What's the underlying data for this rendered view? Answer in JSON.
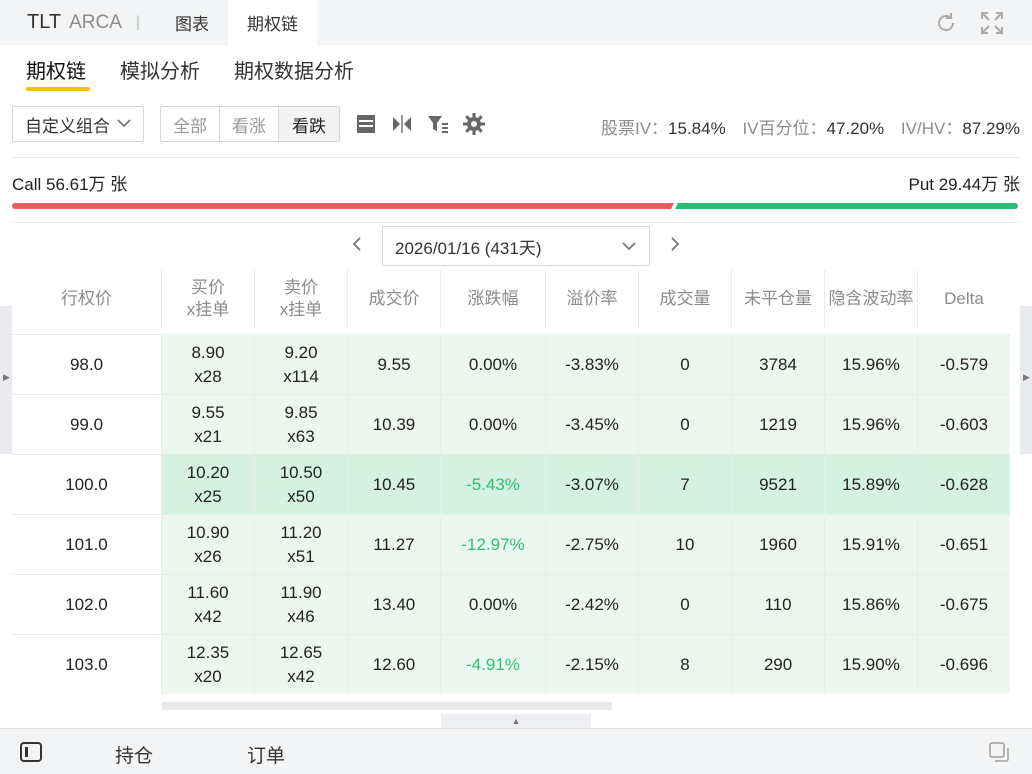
{
  "titlebar": {
    "symbol": "TLT",
    "exchange": "ARCA",
    "separator": "|",
    "tabs": [
      {
        "label": "图表",
        "active": false
      },
      {
        "label": "期权链",
        "active": true
      }
    ],
    "icons": [
      "refresh-icon",
      "fullscreen-icon"
    ]
  },
  "subtabs": [
    {
      "label": "期权链",
      "active": true
    },
    {
      "label": "模拟分析",
      "active": false
    },
    {
      "label": "期权数据分析",
      "active": false
    }
  ],
  "toolbar": {
    "strategy_select": "自定义组合",
    "filters": [
      {
        "label": "全部",
        "active": false
      },
      {
        "label": "看涨",
        "active": false
      },
      {
        "label": "看跌",
        "active": true
      }
    ],
    "icons": [
      "table-layout-icon",
      "mirror-icon",
      "filter-icon",
      "settings-icon"
    ],
    "stats": [
      {
        "label": "股票IV：",
        "value": "15.84%"
      },
      {
        "label": "IV百分位：",
        "value": "47.20%"
      },
      {
        "label": "IV/HV：",
        "value": "87.29%"
      }
    ]
  },
  "volume": {
    "call_label": "Call 56.61万 张",
    "put_label": "Put 29.44万 张",
    "call_share": 0.658,
    "call_color": "#e35d5d",
    "put_color": "#2bbd77"
  },
  "expiry": {
    "selected": "2026/01/16 (431天)",
    "prev": "‹",
    "next": "›"
  },
  "table": {
    "headers": [
      {
        "line1": "行权价",
        "line2": ""
      },
      {
        "line1": "买价",
        "line2": "x挂单"
      },
      {
        "line1": "卖价",
        "line2": "x挂单"
      },
      {
        "line1": "成交价",
        "line2": ""
      },
      {
        "line1": "涨跌幅",
        "line2": ""
      },
      {
        "line1": "溢价率",
        "line2": ""
      },
      {
        "line1": "成交量",
        "line2": ""
      },
      {
        "line1": "未平仓量",
        "line2": ""
      },
      {
        "line1": "隐含波动率",
        "line2": ""
      },
      {
        "line1": "Delta",
        "line2": ""
      }
    ],
    "rows": [
      {
        "strike": "98.0",
        "bid": "8.90",
        "bid_size": "x28",
        "ask": "9.20",
        "ask_size": "x114",
        "last": "9.55",
        "change": "0.00%",
        "premium": "-3.83%",
        "volume": "0",
        "oi": "3784",
        "iv": "15.96%",
        "delta": "-0.579",
        "atm": false,
        "change_dir": "flat"
      },
      {
        "strike": "99.0",
        "bid": "9.55",
        "bid_size": "x21",
        "ask": "9.85",
        "ask_size": "x63",
        "last": "10.39",
        "change": "0.00%",
        "premium": "-3.45%",
        "volume": "0",
        "oi": "1219",
        "iv": "15.96%",
        "delta": "-0.603",
        "atm": false,
        "change_dir": "flat"
      },
      {
        "strike": "100.0",
        "bid": "10.20",
        "bid_size": "x25",
        "ask": "10.50",
        "ask_size": "x50",
        "last": "10.45",
        "change": "-5.43%",
        "premium": "-3.07%",
        "volume": "7",
        "oi": "9521",
        "iv": "15.89%",
        "delta": "-0.628",
        "atm": true,
        "change_dir": "down"
      },
      {
        "strike": "101.0",
        "bid": "10.90",
        "bid_size": "x26",
        "ask": "11.20",
        "ask_size": "x51",
        "last": "11.27",
        "change": "-12.97%",
        "premium": "-2.75%",
        "volume": "10",
        "oi": "1960",
        "iv": "15.91%",
        "delta": "-0.651",
        "atm": false,
        "change_dir": "down"
      },
      {
        "strike": "102.0",
        "bid": "11.60",
        "bid_size": "x42",
        "ask": "11.90",
        "ask_size": "x46",
        "last": "13.40",
        "change": "0.00%",
        "premium": "-2.42%",
        "volume": "0",
        "oi": "110",
        "iv": "15.86%",
        "delta": "-0.675",
        "atm": false,
        "change_dir": "flat"
      },
      {
        "strike": "103.0",
        "bid": "12.35",
        "bid_size": "x20",
        "ask": "12.65",
        "ask_size": "x42",
        "last": "12.60",
        "change": "-4.91%",
        "premium": "-2.15%",
        "volume": "8",
        "oi": "290",
        "iv": "15.90%",
        "delta": "-0.696",
        "atm": false,
        "change_dir": "down"
      }
    ]
  },
  "bottombar": {
    "tabs": [
      "持仓",
      "订单"
    ]
  }
}
